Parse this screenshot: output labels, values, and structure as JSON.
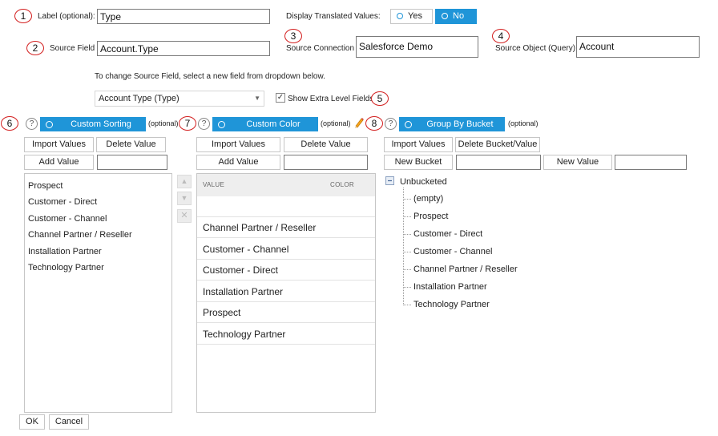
{
  "annotations": [
    "1",
    "2",
    "3",
    "4",
    "5",
    "6",
    "7",
    "8"
  ],
  "label_field": {
    "label": "Label (optional):",
    "value": "Type"
  },
  "translated": {
    "label": "Display Translated Values:",
    "yes": "Yes",
    "no": "No"
  },
  "source_field": {
    "label": "Source Field",
    "value": "Account.Type"
  },
  "source_connection": {
    "label": "Source Connection",
    "value": "Salesforce Demo"
  },
  "source_object": {
    "label": "Source Object (Query)",
    "value": "Account"
  },
  "hint": "To change Source Field, select a new field from dropdown below.",
  "field_select": {
    "value": "Account Type (Type)"
  },
  "extra_level": {
    "label": "Show Extra Level Fields",
    "checked": true
  },
  "custom_sorting": {
    "title": "Custom Sorting",
    "optional": "(optional)",
    "import_label": "Import Values",
    "delete_label": "Delete Value",
    "add_label": "Add Value",
    "items": [
      "Prospect",
      "Customer - Direct",
      "Customer - Channel",
      "Channel Partner / Reseller",
      "Installation Partner",
      "Technology Partner"
    ]
  },
  "custom_color": {
    "title": "Custom Color",
    "optional": "(optional)",
    "import_label": "Import Values",
    "delete_label": "Delete Value",
    "add_label": "Add Value",
    "col_value": "VALUE",
    "col_color": "COLOR",
    "rows": [
      "Channel Partner / Reseller",
      "Customer - Channel",
      "Customer - Direct",
      "Installation Partner",
      "Prospect",
      "Technology Partner"
    ]
  },
  "group_by_bucket": {
    "title": "Group By Bucket",
    "optional": "(optional)",
    "import_label": "Import Values",
    "delete_label": "Delete Bucket/Value",
    "new_bucket_label": "New Bucket",
    "new_value_label": "New Value",
    "root": "Unbucketed",
    "children": [
      "(empty)",
      "Prospect",
      "Customer - Direct",
      "Customer - Channel",
      "Channel Partner / Reseller",
      "Installation Partner",
      "Technology Partner"
    ]
  },
  "footer": {
    "ok": "OK",
    "cancel": "Cancel"
  },
  "colors": {
    "accent": "#1f95d8",
    "annotation": "#d32020"
  },
  "icons": {
    "help": "question-circle-icon",
    "pencil": "pencil-icon",
    "tree_root": "folder-icon"
  }
}
